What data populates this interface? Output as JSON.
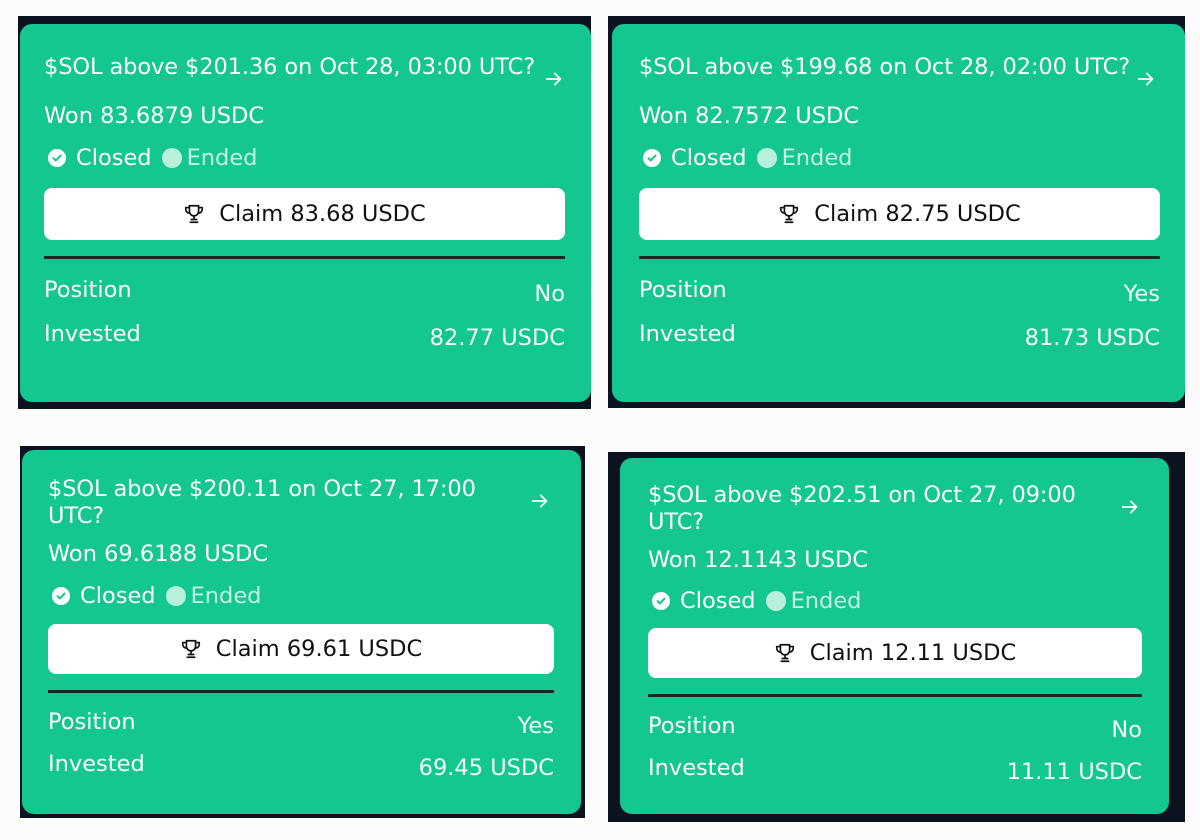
{
  "cards": [
    {
      "title": "$SOL above $201.36 on Oct 28, 03:00 UTC?",
      "won": "Won 83.6879 USDC",
      "status_closed": "Closed",
      "status_ended": "Ended",
      "claim_label": "Claim 83.68 USDC",
      "position_label": "Position",
      "position_value": "No",
      "invested_label": "Invested",
      "invested_value": "82.77 USDC"
    },
    {
      "title": "$SOL above $199.68 on Oct 28, 02:00 UTC?",
      "won": "Won 82.7572 USDC",
      "status_closed": "Closed",
      "status_ended": "Ended",
      "claim_label": "Claim 82.75 USDC",
      "position_label": "Position",
      "position_value": "Yes",
      "invested_label": "Invested",
      "invested_value": "81.73 USDC"
    },
    {
      "title": "$SOL above $200.11 on Oct 27, 17:00 UTC?",
      "won": "Won 69.6188 USDC",
      "status_closed": "Closed",
      "status_ended": "Ended",
      "claim_label": "Claim 69.61 USDC",
      "position_label": "Position",
      "position_value": "Yes",
      "invested_label": "Invested",
      "invested_value": "69.45 USDC"
    },
    {
      "title": "$SOL above $202.51 on Oct 27, 09:00 UTC?",
      "won": "Won 12.1143 USDC",
      "status_closed": "Closed",
      "status_ended": "Ended",
      "claim_label": "Claim 12.11 USDC",
      "position_label": "Position",
      "position_value": "No",
      "invested_label": "Invested",
      "invested_value": "11.11 USDC"
    }
  ],
  "colors": {
    "card": "#14c690",
    "frame": "#0b1220",
    "page": "#fbfbfb"
  },
  "icons": {
    "arrow": "arrow-right-icon",
    "status": "check-circle-icon",
    "ended": "dot-icon",
    "claim": "trophy-icon"
  }
}
